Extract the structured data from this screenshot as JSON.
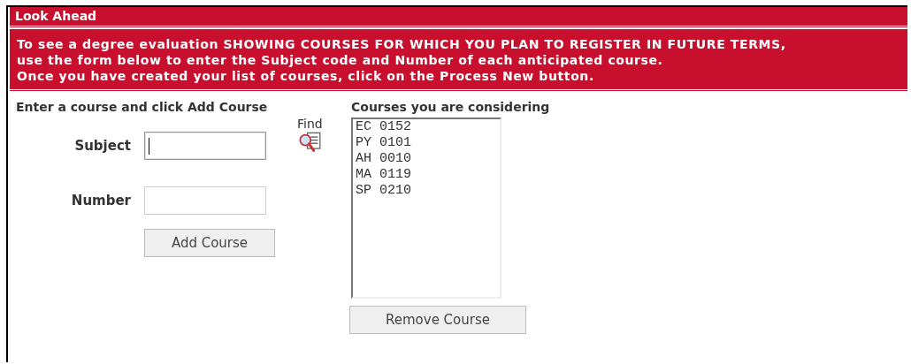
{
  "panel": {
    "title": "Look Ahead"
  },
  "instructions": [
    "To see a degree evaluation SHOWING COURSES FOR WHICH YOU PLAN TO REGISTER IN FUTURE TERMS,",
    "use the form below to enter the Subject code and Number of each anticipated course.",
    "Once you have created your list of courses, click on the Process New button."
  ],
  "entry": {
    "heading": "Enter a course and click Add Course",
    "fields": [
      {
        "label": "Subject",
        "focused": true
      },
      {
        "label": "Number",
        "focused": false
      }
    ],
    "find_label": "Find",
    "button": "Add Course"
  },
  "courses": {
    "heading": "Courses you are considering",
    "items": [
      "EC 0152",
      "PY 0101",
      "AH 0010",
      "MA 0119",
      "SP 0210"
    ],
    "button": "Remove Course"
  }
}
